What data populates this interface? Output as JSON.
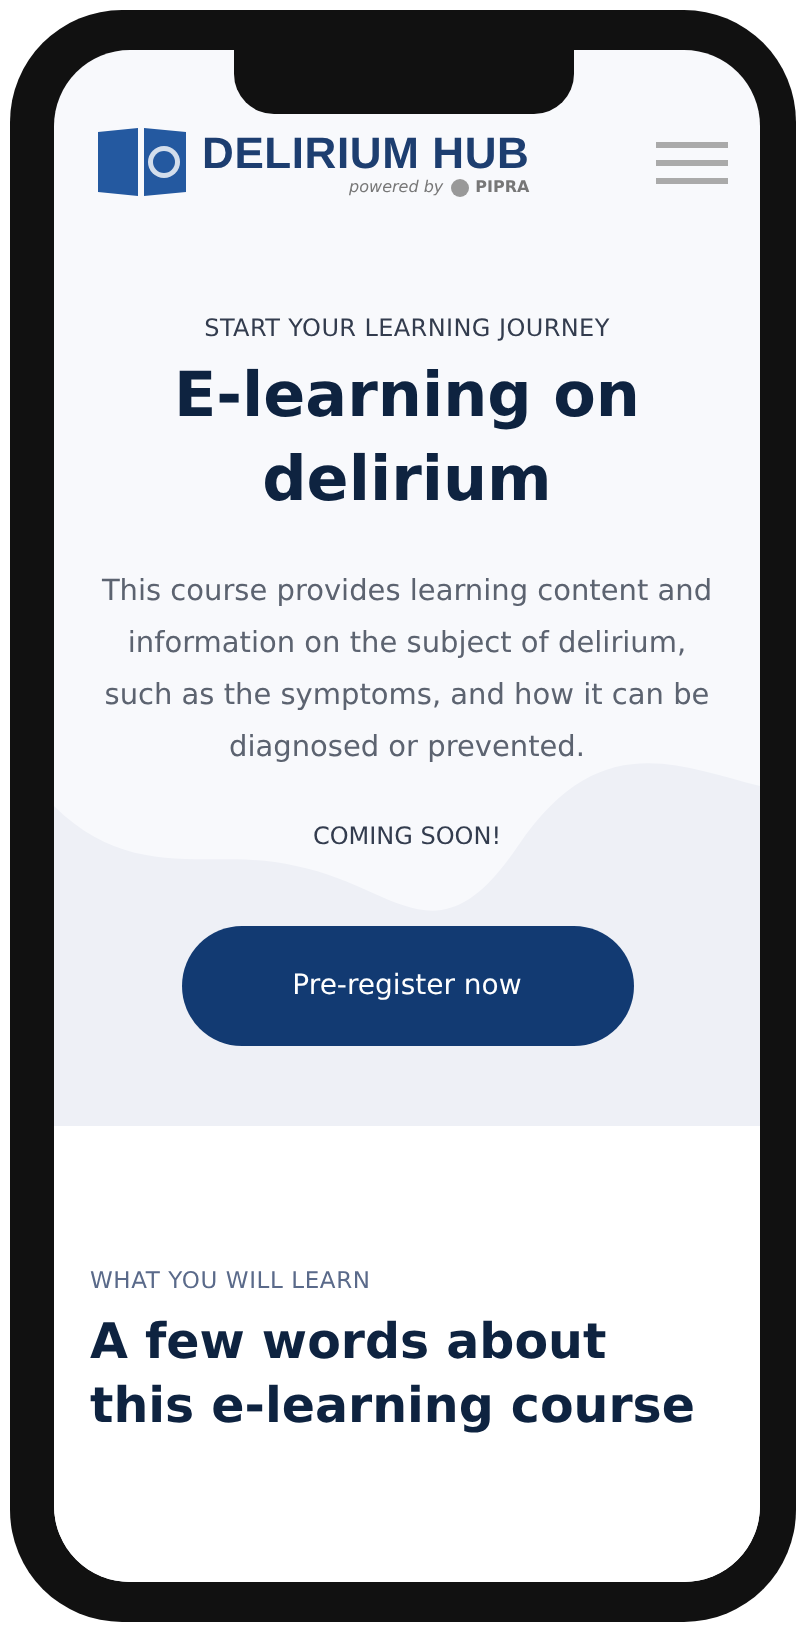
{
  "header": {
    "logo": {
      "title": "DELIRIUM HUB",
      "powered_by": "powered by",
      "partner": "PIPRA"
    }
  },
  "hero": {
    "eyebrow": "START YOUR LEARNING JOURNEY",
    "title": "E-learning on delirium",
    "description": "This course provides learning content and information on the subject of delirium, such as the symptoms, and how it can be diagnosed or prevented.",
    "status": "COMING SOON!",
    "button": "Pre-register now"
  },
  "learn": {
    "eyebrow": "WHAT YOU WILL LEARN",
    "title": "A few words about this e-learning course"
  }
}
